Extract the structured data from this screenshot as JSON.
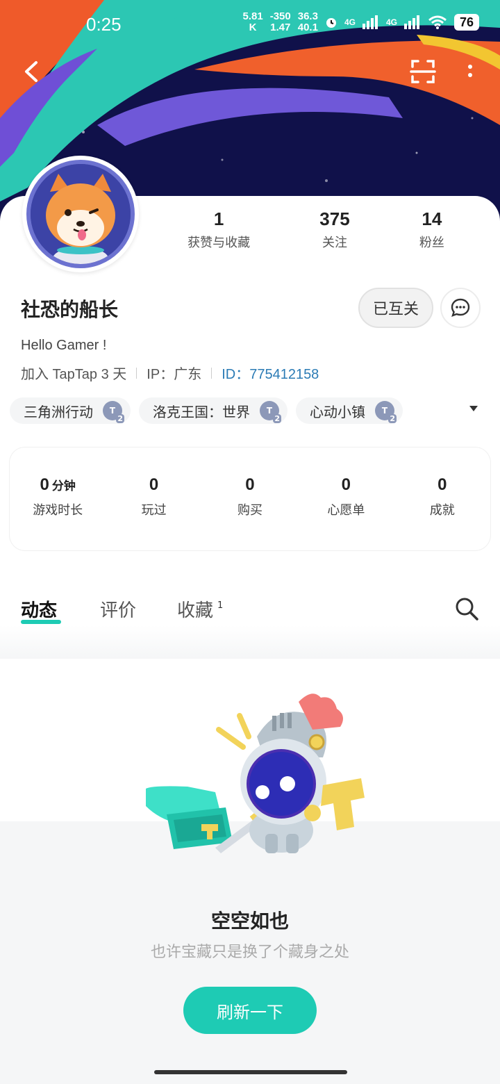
{
  "status_bar": {
    "time": "0:25",
    "net_speed_top": "5.81",
    "net_speed_unit": "K",
    "val1_top": "-350",
    "val1_bottom": "1.47",
    "val2_top": "36.3",
    "val2_bottom": "40.1",
    "signal1": "4G",
    "signal2": "4G",
    "battery": "76"
  },
  "profile": {
    "name": "社恐的船长",
    "bio": "Hello Gamer !",
    "joined": "加入 TapTap 3 天",
    "ip": "IP：广东",
    "id": "ID：775412158",
    "mutual_label": "已互关"
  },
  "stats": [
    {
      "value": "1",
      "label": "获赞与收藏"
    },
    {
      "value": "375",
      "label": "关注"
    },
    {
      "value": "14",
      "label": "粉丝"
    }
  ],
  "game_tags": [
    {
      "name": "三角洲行动",
      "badge": "T",
      "badge_sub": "2"
    },
    {
      "name": "洛克王国：世界",
      "badge": "T",
      "badge_sub": "2"
    },
    {
      "name": "心动小镇",
      "badge": "T",
      "badge_sub": "2"
    }
  ],
  "game_stats": [
    {
      "value": "0",
      "unit": "分钟",
      "label": "游戏时长"
    },
    {
      "value": "0",
      "unit": "",
      "label": "玩过"
    },
    {
      "value": "0",
      "unit": "",
      "label": "购买"
    },
    {
      "value": "0",
      "unit": "",
      "label": "心愿单"
    },
    {
      "value": "0",
      "unit": "",
      "label": "成就"
    }
  ],
  "tabs": [
    {
      "label": "动态",
      "badge": ""
    },
    {
      "label": "评价",
      "badge": ""
    },
    {
      "label": "收藏",
      "badge": "1"
    }
  ],
  "empty_state": {
    "title": "空空如也",
    "subtitle": "也许宝藏只是换了个藏身之处",
    "button": "刷新一下"
  },
  "icons": {
    "back": "back-arrow-icon",
    "scan": "scan-icon",
    "more": "more-vertical-icon",
    "message": "message-icon",
    "search": "search-icon"
  },
  "colors": {
    "accent": "#1ecbb4",
    "id_link": "#2b7bb5"
  }
}
